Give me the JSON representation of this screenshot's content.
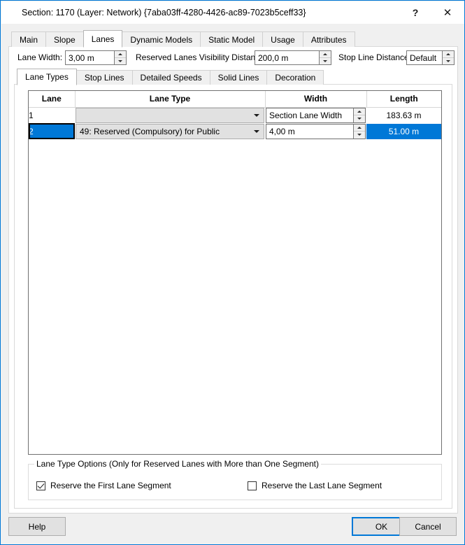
{
  "window": {
    "title": "Section: 1170 (Layer: Network) {7aba03ff-4280-4426-ac89-7023b5ceff33}",
    "help_glyph": "?",
    "close_glyph": "✕"
  },
  "outer_tabs": [
    {
      "label": "Main"
    },
    {
      "label": "Slope"
    },
    {
      "label": "Lanes"
    },
    {
      "label": "Dynamic Models"
    },
    {
      "label": "Static Model"
    },
    {
      "label": "Usage"
    },
    {
      "label": "Attributes"
    }
  ],
  "fields": {
    "lane_width_label": "Lane Width:",
    "lane_width_value": "3,00 m",
    "reserved_vis_label": "Reserved Lanes Visibility Distance:",
    "reserved_vis_value": "200,0 m",
    "stop_line_label": "Stop Line Distance:",
    "stop_line_value": "Default"
  },
  "inner_tabs": [
    {
      "label": "Lane Types"
    },
    {
      "label": "Stop Lines"
    },
    {
      "label": "Detailed Speeds"
    },
    {
      "label": "Solid Lines"
    },
    {
      "label": "Decoration"
    }
  ],
  "table": {
    "columns": [
      "Lane",
      "Lane Type",
      "Width",
      "Length"
    ],
    "rows": [
      {
        "lane": "1",
        "lane_type": "",
        "width": "Section Lane Width",
        "length": "183.63 m",
        "selected": false
      },
      {
        "lane": "2",
        "lane_type": "49: Reserved (Compulsory) for Public",
        "width": "4,00 m",
        "length": "51.00 m",
        "selected": true
      }
    ]
  },
  "groupbox": {
    "title": "Lane Type Options (Only for Reserved Lanes with More than One Segment)",
    "checkbox_first": {
      "label": "Reserve the First Lane Segment",
      "checked": true
    },
    "checkbox_last": {
      "label": "Reserve the Last Lane Segment",
      "checked": false
    }
  },
  "buttons": {
    "help": "Help",
    "ok": "OK",
    "cancel": "Cancel"
  },
  "colors": {
    "accent": "#0078d7",
    "selection": "#0078d7",
    "dialog_bg": "#f0f0f0"
  }
}
